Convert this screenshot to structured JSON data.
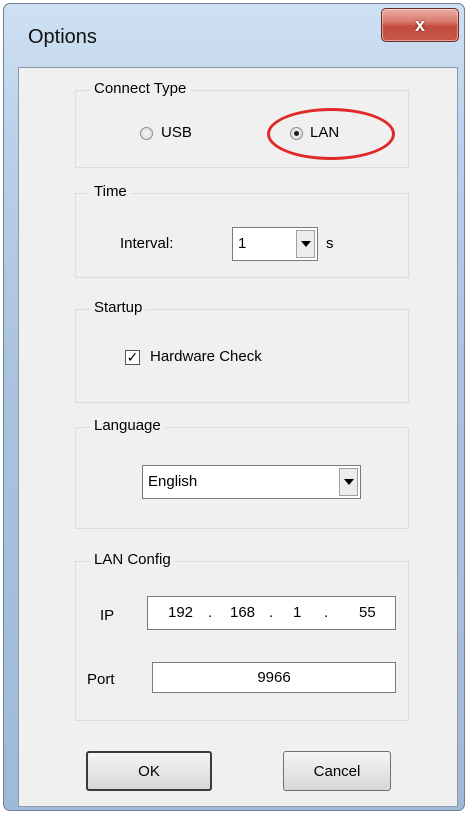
{
  "window": {
    "title": "Options",
    "close_glyph": "x"
  },
  "connect_type": {
    "legend": "Connect Type",
    "options": [
      {
        "label": "USB",
        "selected": false
      },
      {
        "label": "LAN",
        "selected": true
      }
    ],
    "highlight_color": "#e02a2a"
  },
  "time": {
    "legend": "Time",
    "interval_label": "Interval:",
    "interval_value": "1",
    "unit": "s"
  },
  "startup": {
    "legend": "Startup",
    "hardware_check_label": "Hardware Check",
    "hardware_check_checked": true,
    "check_glyph": "✓"
  },
  "language": {
    "legend": "Language",
    "selected": "English"
  },
  "lan_config": {
    "legend": "LAN Config",
    "ip_label": "IP",
    "ip": [
      "192",
      "168",
      "1",
      "55"
    ],
    "ip_sep": ".",
    "port_label": "Port",
    "port": "9966"
  },
  "buttons": {
    "ok": "OK",
    "cancel": "Cancel"
  }
}
